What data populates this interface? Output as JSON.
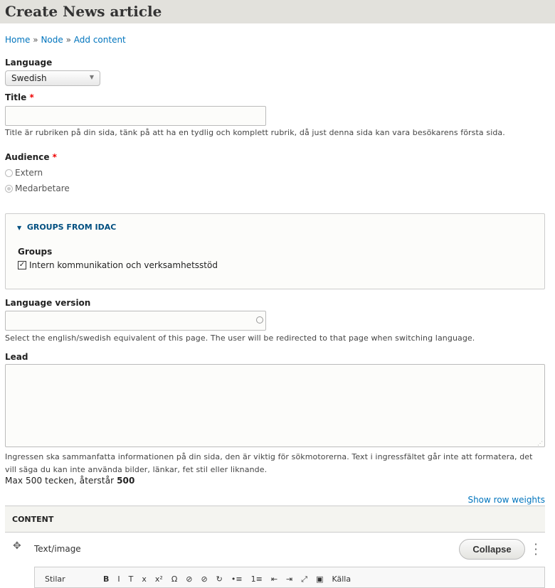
{
  "header": {
    "title": "Create News article"
  },
  "breadcrumb": [
    {
      "label": "Home"
    },
    {
      "label": "Node"
    },
    {
      "label": "Add content"
    }
  ],
  "breadcrumb_sep": "»",
  "language": {
    "label": "Language",
    "value": "Swedish"
  },
  "title_field": {
    "label": "Title",
    "required": "*",
    "value": "",
    "description": "Title är rubriken på din sida, tänk på att ha en tydlig och komplett rubrik, då just denna sida kan vara besökarens första sida."
  },
  "audience": {
    "label": "Audience",
    "required": "*",
    "options": [
      {
        "label": "Extern",
        "checked": false
      },
      {
        "label": "Medarbetare",
        "checked": true
      }
    ]
  },
  "groups_fieldset": {
    "legend": "GROUPS FROM IDAC",
    "groups_label": "Groups",
    "checkbox": {
      "label": "Intern kommunikation och verksamhetsstöd",
      "checked": true
    }
  },
  "language_version": {
    "label": "Language version",
    "value": "",
    "description": "Select the english/swedish equivalent of this page. The user will be redirected to that page when switching language."
  },
  "lead": {
    "label": "Lead",
    "value": "",
    "description": "Ingressen ska sammanfatta informationen på din sida, den är viktig för sökmotorerna. Text i ingressfältet går inte att formatera, det vill säga du kan inte använda bilder, länkar, fet stil eller liknande.",
    "max_prefix": "Max 500 tecken, återstår",
    "max_remaining": "500"
  },
  "show_row_weights": "Show row weights",
  "content": {
    "heading": "CONTENT",
    "item": "Text/image",
    "collapse": "Collapse"
  },
  "toolbar": {
    "style": "Stilar",
    "items": [
      "B",
      "I",
      "T",
      "x",
      "x²",
      "Ω",
      "⊘",
      "⊘",
      "↻",
      "•≡",
      "1≡",
      "⇤",
      "⇥",
      "⤢",
      "▣",
      "Källa"
    ]
  },
  "colors": {
    "link": "#0074bd",
    "header_bg": "#e2e1dc",
    "required": "#e00000"
  }
}
